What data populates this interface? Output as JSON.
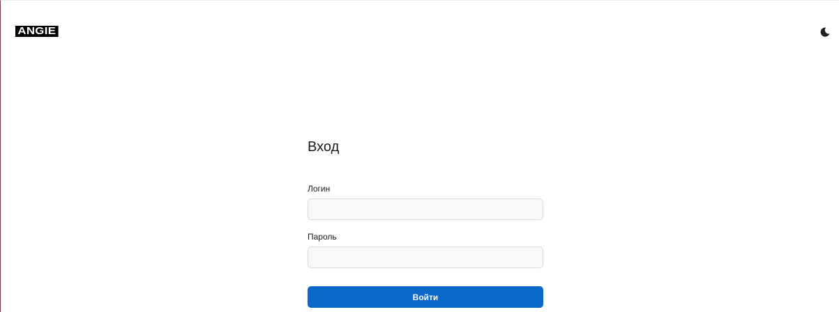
{
  "header": {
    "logo_text": "ANGIE",
    "theme_toggle_icon": "moon-icon"
  },
  "login_form": {
    "title": "Вход",
    "username_label": "Логин",
    "username_value": "",
    "password_label": "Пароль",
    "password_value": "",
    "submit_label": "Войти"
  },
  "colors": {
    "accent": "#0a68c9",
    "input_background": "#f7f8fa",
    "input_border": "#d8dbe0",
    "logo_background": "#000000"
  }
}
